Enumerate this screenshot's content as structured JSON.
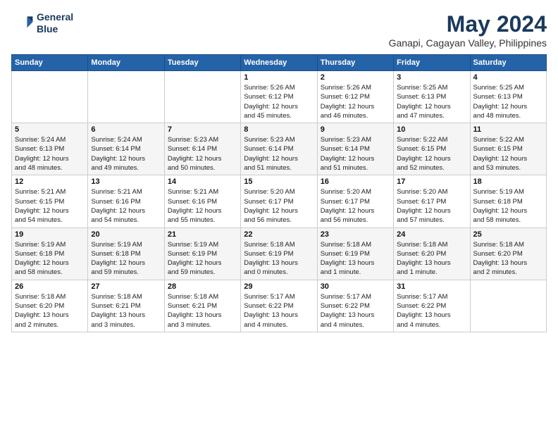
{
  "header": {
    "logo_line1": "General",
    "logo_line2": "Blue",
    "title": "May 2024",
    "subtitle": "Ganapi, Cagayan Valley, Philippines"
  },
  "days_of_week": [
    "Sunday",
    "Monday",
    "Tuesday",
    "Wednesday",
    "Thursday",
    "Friday",
    "Saturday"
  ],
  "weeks": [
    [
      {
        "date": "",
        "text": ""
      },
      {
        "date": "",
        "text": ""
      },
      {
        "date": "",
        "text": ""
      },
      {
        "date": "1",
        "text": "Sunrise: 5:26 AM\nSunset: 6:12 PM\nDaylight: 12 hours\nand 45 minutes."
      },
      {
        "date": "2",
        "text": "Sunrise: 5:26 AM\nSunset: 6:12 PM\nDaylight: 12 hours\nand 46 minutes."
      },
      {
        "date": "3",
        "text": "Sunrise: 5:25 AM\nSunset: 6:13 PM\nDaylight: 12 hours\nand 47 minutes."
      },
      {
        "date": "4",
        "text": "Sunrise: 5:25 AM\nSunset: 6:13 PM\nDaylight: 12 hours\nand 48 minutes."
      }
    ],
    [
      {
        "date": "5",
        "text": "Sunrise: 5:24 AM\nSunset: 6:13 PM\nDaylight: 12 hours\nand 48 minutes."
      },
      {
        "date": "6",
        "text": "Sunrise: 5:24 AM\nSunset: 6:14 PM\nDaylight: 12 hours\nand 49 minutes."
      },
      {
        "date": "7",
        "text": "Sunrise: 5:23 AM\nSunset: 6:14 PM\nDaylight: 12 hours\nand 50 minutes."
      },
      {
        "date": "8",
        "text": "Sunrise: 5:23 AM\nSunset: 6:14 PM\nDaylight: 12 hours\nand 51 minutes."
      },
      {
        "date": "9",
        "text": "Sunrise: 5:23 AM\nSunset: 6:14 PM\nDaylight: 12 hours\nand 51 minutes."
      },
      {
        "date": "10",
        "text": "Sunrise: 5:22 AM\nSunset: 6:15 PM\nDaylight: 12 hours\nand 52 minutes."
      },
      {
        "date": "11",
        "text": "Sunrise: 5:22 AM\nSunset: 6:15 PM\nDaylight: 12 hours\nand 53 minutes."
      }
    ],
    [
      {
        "date": "12",
        "text": "Sunrise: 5:21 AM\nSunset: 6:15 PM\nDaylight: 12 hours\nand 54 minutes."
      },
      {
        "date": "13",
        "text": "Sunrise: 5:21 AM\nSunset: 6:16 PM\nDaylight: 12 hours\nand 54 minutes."
      },
      {
        "date": "14",
        "text": "Sunrise: 5:21 AM\nSunset: 6:16 PM\nDaylight: 12 hours\nand 55 minutes."
      },
      {
        "date": "15",
        "text": "Sunrise: 5:20 AM\nSunset: 6:17 PM\nDaylight: 12 hours\nand 56 minutes."
      },
      {
        "date": "16",
        "text": "Sunrise: 5:20 AM\nSunset: 6:17 PM\nDaylight: 12 hours\nand 56 minutes."
      },
      {
        "date": "17",
        "text": "Sunrise: 5:20 AM\nSunset: 6:17 PM\nDaylight: 12 hours\nand 57 minutes."
      },
      {
        "date": "18",
        "text": "Sunrise: 5:19 AM\nSunset: 6:18 PM\nDaylight: 12 hours\nand 58 minutes."
      }
    ],
    [
      {
        "date": "19",
        "text": "Sunrise: 5:19 AM\nSunset: 6:18 PM\nDaylight: 12 hours\nand 58 minutes."
      },
      {
        "date": "20",
        "text": "Sunrise: 5:19 AM\nSunset: 6:18 PM\nDaylight: 12 hours\nand 59 minutes."
      },
      {
        "date": "21",
        "text": "Sunrise: 5:19 AM\nSunset: 6:19 PM\nDaylight: 12 hours\nand 59 minutes."
      },
      {
        "date": "22",
        "text": "Sunrise: 5:18 AM\nSunset: 6:19 PM\nDaylight: 13 hours\nand 0 minutes."
      },
      {
        "date": "23",
        "text": "Sunrise: 5:18 AM\nSunset: 6:19 PM\nDaylight: 13 hours\nand 1 minute."
      },
      {
        "date": "24",
        "text": "Sunrise: 5:18 AM\nSunset: 6:20 PM\nDaylight: 13 hours\nand 1 minute."
      },
      {
        "date": "25",
        "text": "Sunrise: 5:18 AM\nSunset: 6:20 PM\nDaylight: 13 hours\nand 2 minutes."
      }
    ],
    [
      {
        "date": "26",
        "text": "Sunrise: 5:18 AM\nSunset: 6:20 PM\nDaylight: 13 hours\nand 2 minutes."
      },
      {
        "date": "27",
        "text": "Sunrise: 5:18 AM\nSunset: 6:21 PM\nDaylight: 13 hours\nand 3 minutes."
      },
      {
        "date": "28",
        "text": "Sunrise: 5:18 AM\nSunset: 6:21 PM\nDaylight: 13 hours\nand 3 minutes."
      },
      {
        "date": "29",
        "text": "Sunrise: 5:17 AM\nSunset: 6:22 PM\nDaylight: 13 hours\nand 4 minutes."
      },
      {
        "date": "30",
        "text": "Sunrise: 5:17 AM\nSunset: 6:22 PM\nDaylight: 13 hours\nand 4 minutes."
      },
      {
        "date": "31",
        "text": "Sunrise: 5:17 AM\nSunset: 6:22 PM\nDaylight: 13 hours\nand 4 minutes."
      },
      {
        "date": "",
        "text": ""
      }
    ]
  ]
}
